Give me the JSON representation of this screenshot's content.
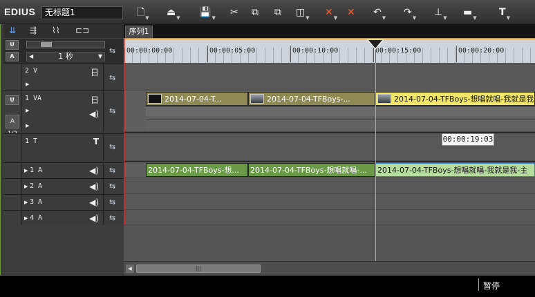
{
  "app": {
    "brand": "EDIUS",
    "project_name": "无标题1"
  },
  "toolbar": {
    "buttons": [
      {
        "name": "new-project",
        "glyph": "🗋"
      },
      {
        "name": "open-project",
        "glyph": "⏏"
      },
      {
        "name": "save-project",
        "glyph": "💾"
      },
      {
        "name": "cut",
        "glyph": "✂"
      },
      {
        "name": "copy",
        "glyph": "⧉"
      },
      {
        "name": "paste",
        "glyph": "⧉"
      },
      {
        "name": "replace",
        "glyph": "◫"
      },
      {
        "name": "delete-gap",
        "glyph": "✕"
      },
      {
        "name": "ripple-delete",
        "glyph": "✕"
      },
      {
        "name": "undo",
        "glyph": "↶"
      },
      {
        "name": "redo",
        "glyph": "↷"
      },
      {
        "name": "add-marker",
        "glyph": "⊥"
      },
      {
        "name": "sequence-marker",
        "glyph": "▬"
      },
      {
        "name": "title",
        "glyph": "T"
      }
    ]
  },
  "left_panel": {
    "mode_buttons": {
      "u_label": "U",
      "a_label": "A"
    },
    "scale_label": "1 秒",
    "tracks": [
      {
        "id": "2v",
        "name": "2 V"
      },
      {
        "id": "1va",
        "name": "1 VA",
        "side_label": "A 1/2"
      },
      {
        "id": "1t",
        "name": "1 T",
        "glyph": "T"
      },
      {
        "id": "1a",
        "name": "1 A"
      },
      {
        "id": "2a",
        "name": "2 A"
      },
      {
        "id": "3a",
        "name": "3 A"
      },
      {
        "id": "4a",
        "name": "4 A"
      }
    ]
  },
  "timeline": {
    "sequence_tab": "序列1",
    "ruler_labels": [
      "00:00:00:00",
      "00:00:05:00",
      "00:00:10:00",
      "00:00:15:00",
      "00:00:20:00"
    ],
    "video_clips": [
      {
        "label": "2014-07-04-T...",
        "selected": false
      },
      {
        "label": "2014-07-04-TFBoys-...",
        "selected": false
      },
      {
        "label": "2014-07-04-TFBoys-想唱就唱-我就是我",
        "selected": true
      }
    ],
    "audio_clips": [
      {
        "label": "2014-07-04-TFBoys-想...",
        "selected": false
      },
      {
        "label": "2014-07-04-TFBoys-想唱就唱-...",
        "selected": false
      },
      {
        "label": "2014-07-04-TFBoys-想唱就唱-我就是我-主",
        "selected": true
      }
    ],
    "tooltip_time": "00:00:19:03"
  },
  "status": {
    "text": "暂停"
  }
}
